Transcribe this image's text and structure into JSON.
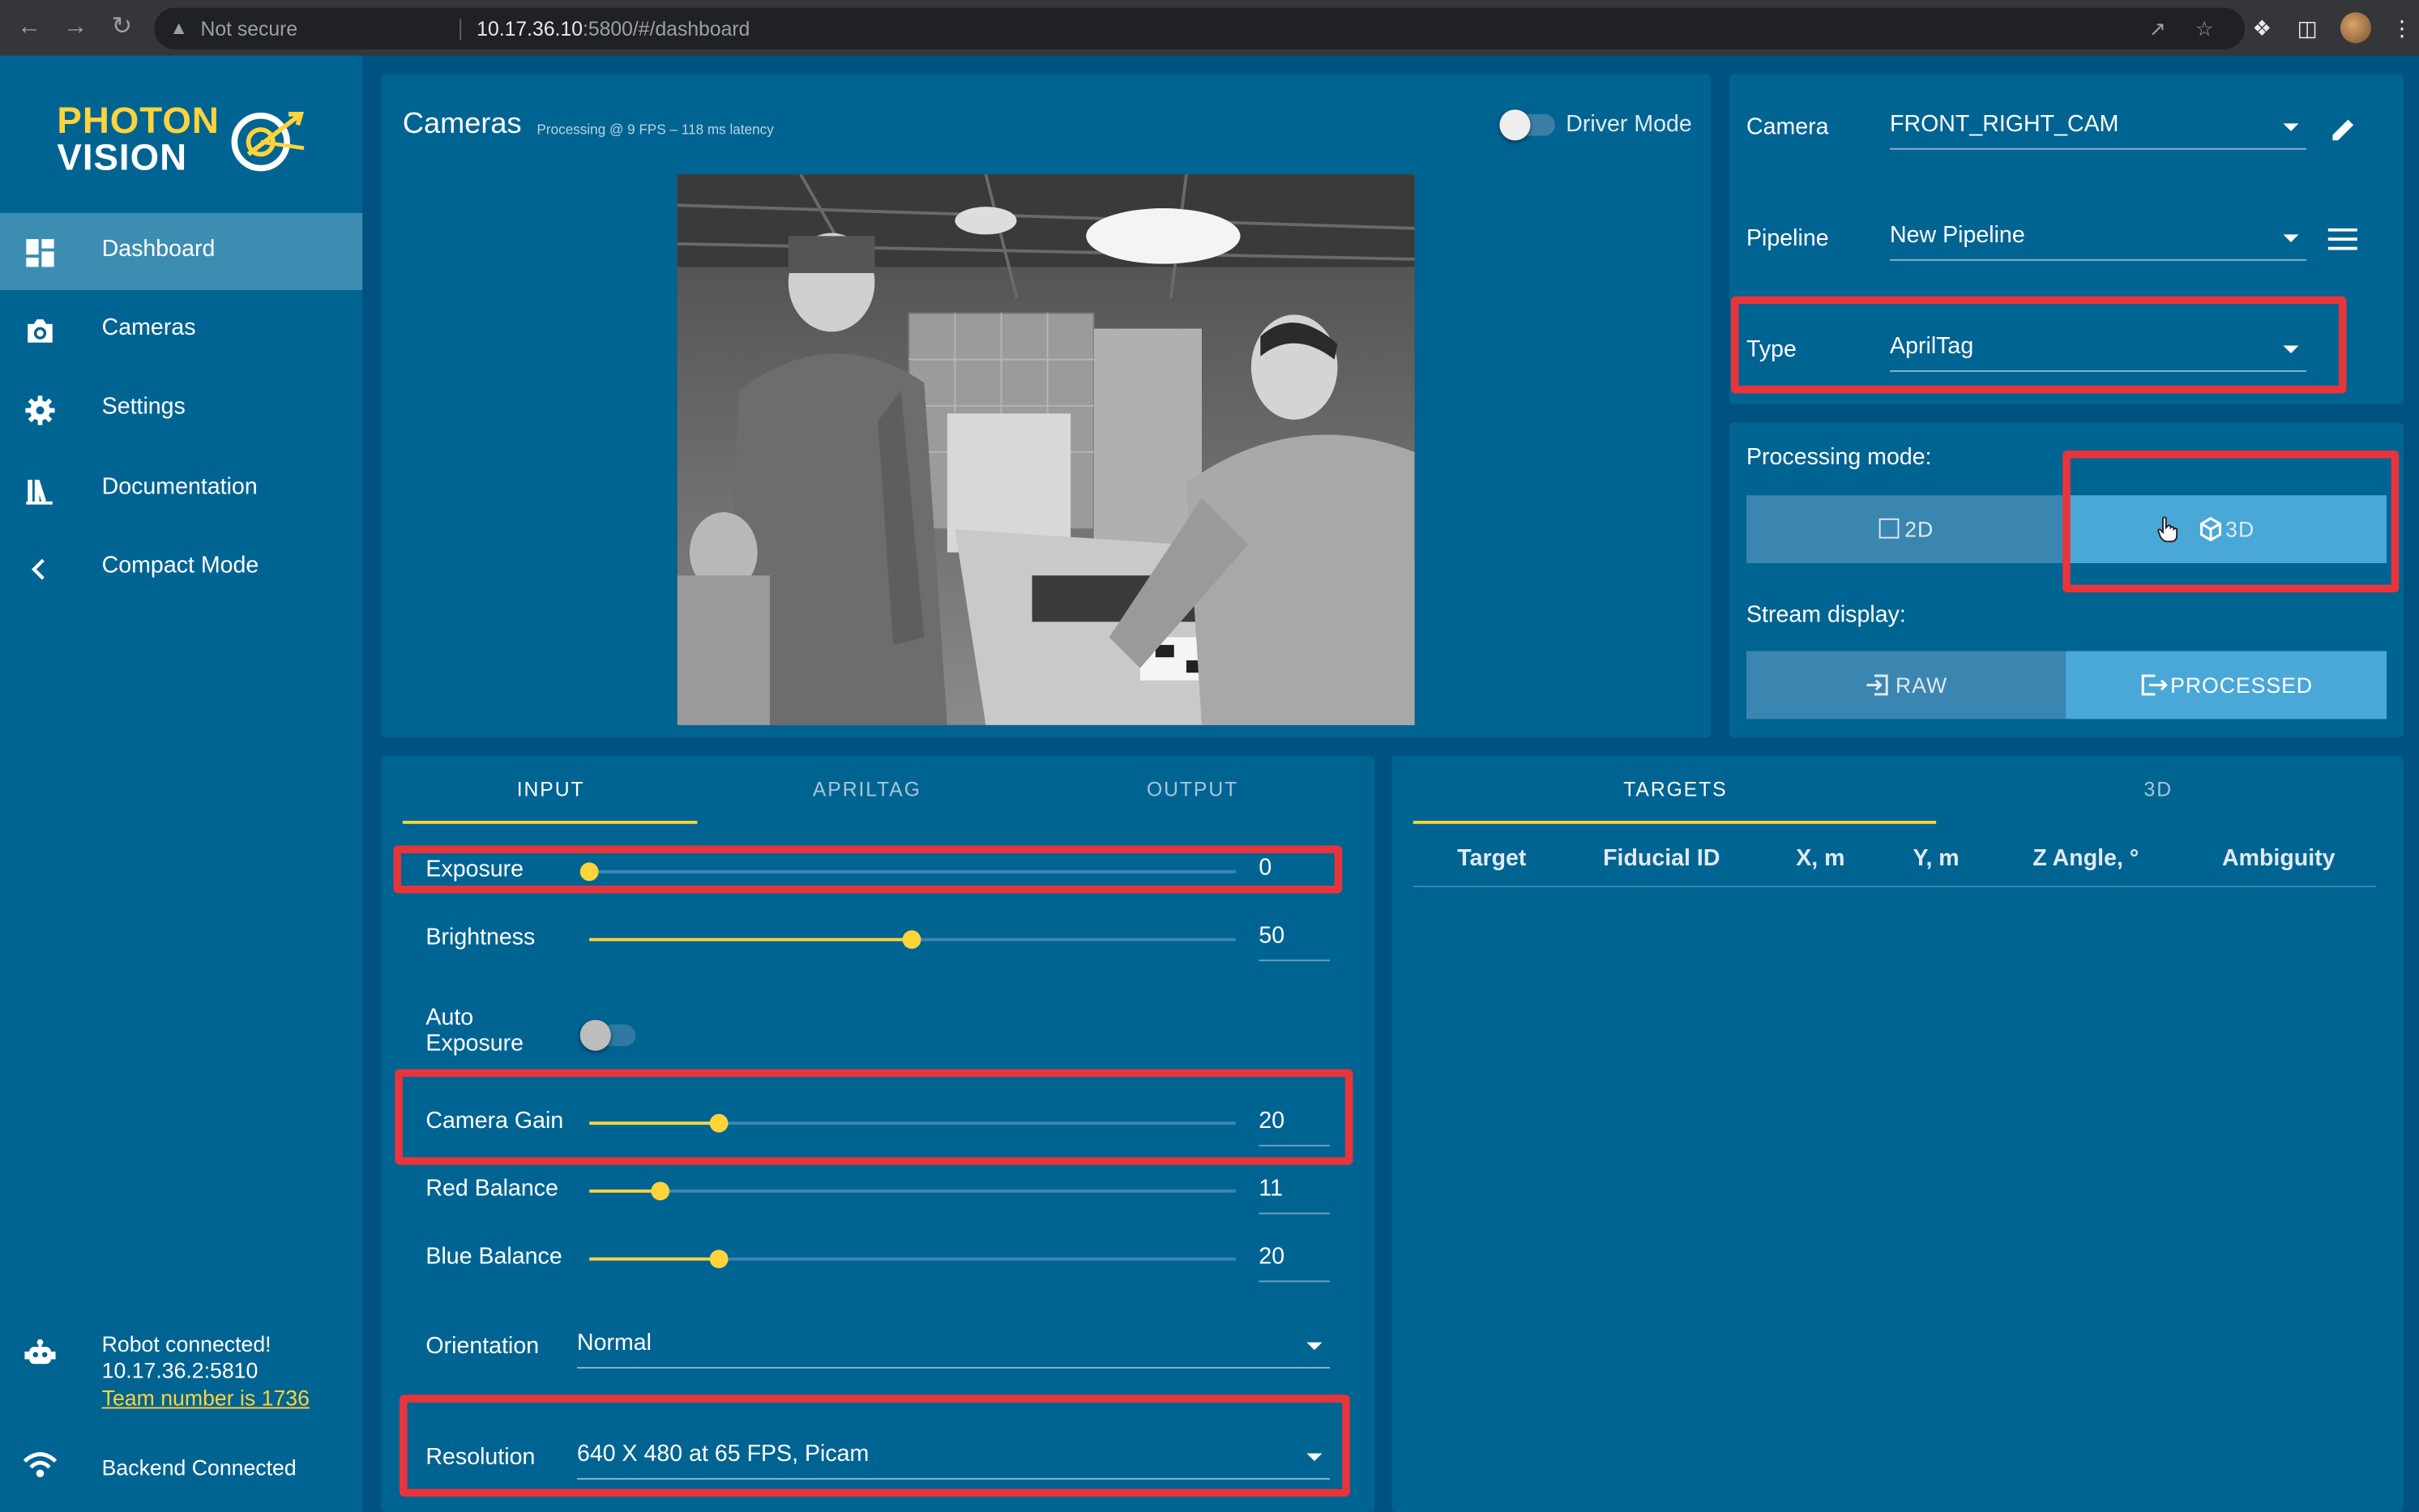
{
  "browser": {
    "security_label": "Not secure",
    "url_host": "10.17.36.10",
    "url_path": ":5800/#/dashboard"
  },
  "logo": {
    "line1": "PHOTON",
    "line2": "VISION"
  },
  "sidebar": {
    "items": [
      {
        "label": "Dashboard",
        "icon": "dashboard-icon",
        "active": true
      },
      {
        "label": "Cameras",
        "icon": "camera-icon"
      },
      {
        "label": "Settings",
        "icon": "gear-icon"
      },
      {
        "label": "Documentation",
        "icon": "books-icon"
      },
      {
        "label": "Compact Mode",
        "icon": "chevron-left-icon"
      }
    ],
    "robot_status": {
      "line1": "Robot connected!",
      "line2": "10.17.36.2:5810",
      "team_link": "Team number is 1736"
    },
    "backend_status": "Backend Connected"
  },
  "cameras_card": {
    "title": "Cameras",
    "subtitle": "Processing @ 9 FPS – 118 ms latency",
    "driver_mode_label": "Driver Mode",
    "driver_mode_on": false
  },
  "config": {
    "camera_label": "Camera",
    "camera_value": "FRONT_RIGHT_CAM",
    "pipeline_label": "Pipeline",
    "pipeline_value": "New Pipeline",
    "type_label": "Type",
    "type_value": "AprilTag"
  },
  "modes": {
    "processing_label": "Processing mode:",
    "processing_options": [
      "2D",
      "3D"
    ],
    "processing_selected": "3D",
    "stream_label": "Stream display:",
    "stream_options": [
      "RAW",
      "PROCESSED"
    ],
    "stream_selected": "PROCESSED"
  },
  "settings_tabs": [
    "INPUT",
    "APRILTAG",
    "OUTPUT"
  ],
  "settings_active_tab": "INPUT",
  "input": {
    "sliders": [
      {
        "label": "Exposure",
        "value": "0",
        "fraction": 0.0
      },
      {
        "label": "Brightness",
        "value": "50",
        "fraction": 0.5
      },
      {
        "label": "Camera Gain",
        "value": "20",
        "fraction": 0.2
      },
      {
        "label": "Red Balance",
        "value": "11",
        "fraction": 0.11
      },
      {
        "label": "Blue Balance",
        "value": "20",
        "fraction": 0.2
      }
    ],
    "auto_exposure_line1": "Auto",
    "auto_exposure_line2": "Exposure",
    "auto_exposure_on": false,
    "orientation_label": "Orientation",
    "orientation_value": "Normal",
    "resolution_label": "Resolution",
    "resolution_value": "640 X 480 at 65 FPS, Picam"
  },
  "targets_tabs": [
    "TARGETS",
    "3D"
  ],
  "targets_active_tab": "TARGETS",
  "targets_columns": [
    "Target",
    "Fiducial ID",
    "X, m",
    "Y, m",
    "Z Angle, °",
    "Ambiguity"
  ],
  "colors": {
    "sidebar": "#006492",
    "background": "#005281",
    "accent_yellow": "#ffd43a",
    "highlight_red": "#e8353b"
  }
}
